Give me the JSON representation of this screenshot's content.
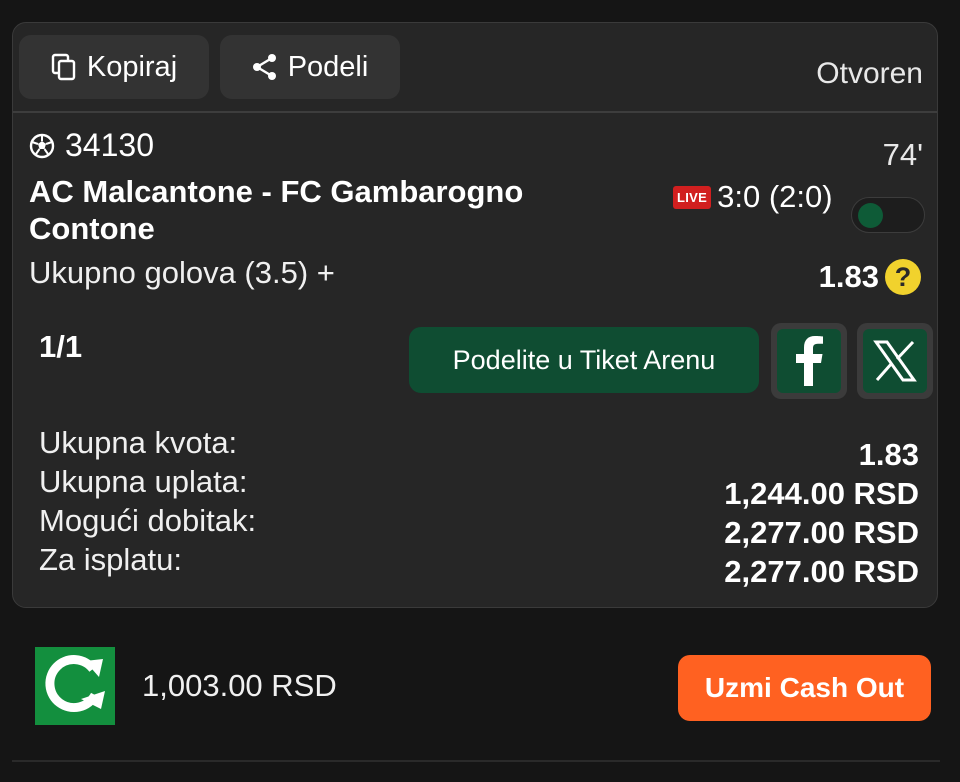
{
  "toolbar": {
    "copy_label": "Kopiraj",
    "share_label": "Podeli",
    "status": "Otvoren"
  },
  "event": {
    "id": "34130",
    "minute": "74'",
    "match": "AC Malcantone - FC Gambarogno Contone",
    "live_badge": "LIVE",
    "score": "3:0 (2:0)",
    "market": "Ukupno golova (3.5) +",
    "odd": "1.83",
    "help": "?"
  },
  "ticket": {
    "combo": "1/1",
    "arena_button": "Podelite u Tiket Arenu"
  },
  "summary": [
    {
      "label": "Ukupna kvota:",
      "value": "1.83"
    },
    {
      "label": "Ukupna uplata:",
      "value": "1,244.00 RSD"
    },
    {
      "label": "Mogući dobitak:",
      "value": "2,277.00 RSD"
    },
    {
      "label": "Za isplatu:",
      "value": "2,277.00 RSD"
    }
  ],
  "cashout": {
    "amount": "1,003.00 RSD",
    "button": "Uzmi Cash Out"
  },
  "colors": {
    "accent_green": "#0f4d32",
    "cashout_orange": "#ff6121",
    "live_red": "#d11f1f",
    "help_yellow": "#f1d22d"
  },
  "icons": [
    "copy-icon",
    "share-icon",
    "soccer-ball-icon",
    "facebook-icon",
    "x-icon",
    "cashout-logo-icon"
  ]
}
